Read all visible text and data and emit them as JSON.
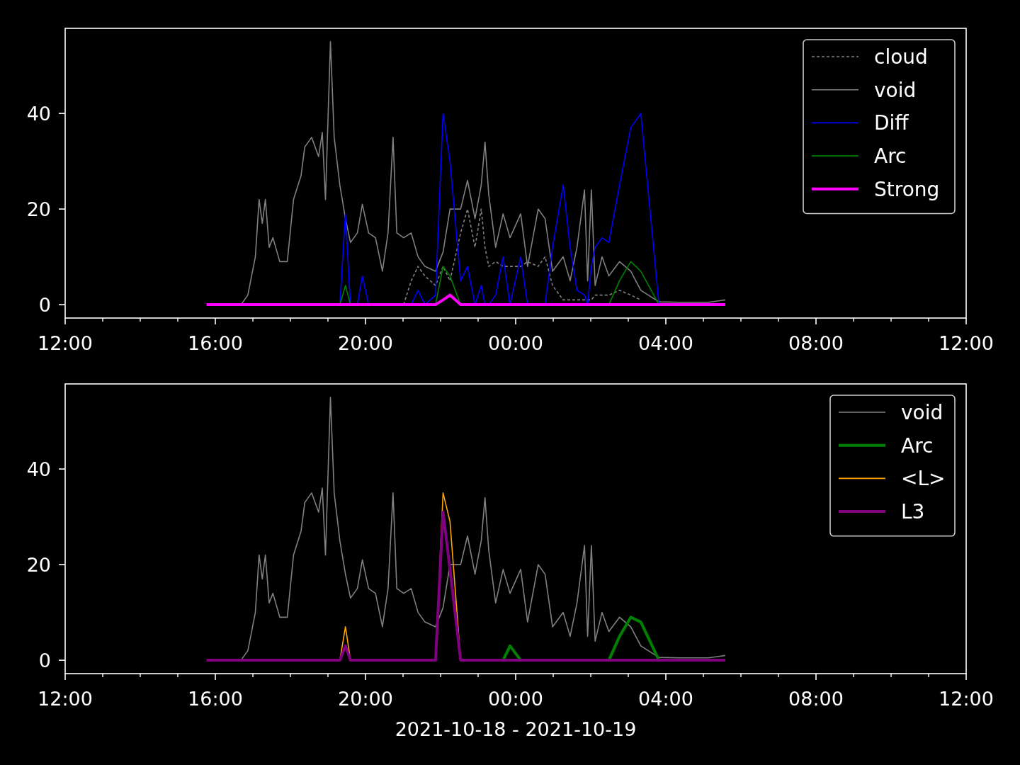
{
  "figure": {
    "charts": [
      {
        "line_kinds": [
          {
            "kind": "thin"
          },
          {
            "kind": "thin"
          },
          {
            "kind": "thin"
          },
          {
            "kind": "thin"
          },
          {
            "kind": "thick"
          }
        ],
        "chart_data": {
          "type": "line",
          "legend": true,
          "xlim": [
            "2021-10-18T12:00",
            "2021-10-19T12:00"
          ],
          "ylim": [
            -2.8,
            57.8
          ],
          "yticks": [
            0,
            20,
            40
          ],
          "xticks": [
            {
              "value": "2021-10-18T12:00",
              "label": "12:00"
            },
            {
              "value": "2021-10-18T16:00",
              "label": "16:00"
            },
            {
              "value": "2021-10-18T20:00",
              "label": "20:00"
            },
            {
              "value": "2021-10-19T00:00",
              "label": "00:00"
            },
            {
              "value": "2021-10-19T04:00",
              "label": "04:00"
            },
            {
              "value": "2021-10-19T08:00",
              "label": "08:00"
            },
            {
              "value": "2021-10-19T12:00",
              "label": "12:00"
            }
          ],
          "x": [
            "2021-10-18T15:46",
            "2021-10-18T16:41",
            "2021-10-18T16:52",
            "2021-10-18T17:04",
            "2021-10-18T17:10",
            "2021-10-18T17:15",
            "2021-10-18T17:20",
            "2021-10-18T17:26",
            "2021-10-18T17:32",
            "2021-10-18T17:43",
            "2021-10-18T17:55",
            "2021-10-18T18:05",
            "2021-10-18T18:17",
            "2021-10-18T18:23",
            "2021-10-18T18:34",
            "2021-10-18T18:45",
            "2021-10-18T18:51",
            "2021-10-18T18:56",
            "2021-10-18T19:04",
            "2021-10-18T19:10",
            "2021-10-18T19:19",
            "2021-10-18T19:28",
            "2021-10-18T19:36",
            "2021-10-18T19:47",
            "2021-10-18T19:55",
            "2021-10-18T20:05",
            "2021-10-18T20:16",
            "2021-10-18T20:27",
            "2021-10-18T20:36",
            "2021-10-18T20:44",
            "2021-10-18T20:50",
            "2021-10-18T21:01",
            "2021-10-18T21:13",
            "2021-10-18T21:24",
            "2021-10-18T21:35",
            "2021-10-18T21:52",
            "2021-10-18T22:04",
            "2021-10-18T22:15",
            "2021-10-18T22:32",
            "2021-10-18T22:43",
            "2021-10-18T22:55",
            "2021-10-18T23:05",
            "2021-10-18T23:11",
            "2021-10-18T23:17",
            "2021-10-18T23:28",
            "2021-10-18T23:40",
            "2021-10-18T23:51",
            "2021-10-19T00:08",
            "2021-10-19T00:19",
            "2021-10-19T00:36",
            "2021-10-19T00:47",
            "2021-10-19T00:59",
            "2021-10-19T01:16",
            "2021-10-19T01:27",
            "2021-10-19T01:38",
            "2021-10-19T01:50",
            "2021-10-19T01:55",
            "2021-10-19T02:01",
            "2021-10-19T02:07",
            "2021-10-19T02:18",
            "2021-10-19T02:29",
            "2021-10-19T02:46",
            "2021-10-19T03:04",
            "2021-10-19T03:20",
            "2021-10-19T03:49",
            "2021-10-19T04:23",
            "2021-10-19T05:08",
            "2021-10-19T05:35"
          ],
          "series": [
            {
              "name": "cloud",
              "color": "#808080",
              "line_style": "dashed",
              "values": [
                null,
                null,
                null,
                null,
                null,
                null,
                null,
                null,
                null,
                null,
                null,
                null,
                null,
                null,
                null,
                null,
                null,
                null,
                null,
                null,
                null,
                null,
                null,
                null,
                null,
                null,
                null,
                null,
                null,
                null,
                null,
                0,
                5,
                8,
                6,
                4,
                8,
                5,
                15,
                20,
                12,
                20,
                12,
                8,
                9,
                8,
                8,
                8,
                9,
                8,
                10,
                4,
                1,
                1,
                1,
                1,
                1,
                1,
                2,
                2,
                2,
                3,
                2,
                1,
                null,
                null,
                null,
                null
              ]
            },
            {
              "name": "void",
              "color": "#808080",
              "line_style": "solid",
              "values": [
                null,
                0,
                2,
                10,
                22,
                17,
                22,
                12,
                14,
                9,
                9,
                22,
                27,
                33,
                35,
                31,
                36,
                22,
                55,
                35,
                25,
                18,
                13,
                15,
                21,
                15,
                14,
                7,
                15,
                35,
                15,
                14,
                15,
                10,
                8,
                7,
                11,
                20,
                20,
                26,
                18,
                25,
                34,
                23,
                12,
                19,
                14,
                19,
                8,
                20,
                18,
                7,
                10,
                5,
                12,
                24,
                5,
                24,
                4,
                10,
                6,
                9,
                7,
                3,
                0.6,
                0.5,
                0.5,
                1
              ]
            },
            {
              "name": "Diff",
              "color": "#0000ff",
              "line_style": "solid",
              "values": [
                null,
                null,
                null,
                null,
                null,
                null,
                null,
                null,
                null,
                null,
                null,
                null,
                null,
                null,
                null,
                null,
                null,
                null,
                null,
                null,
                0,
                19,
                0,
                0,
                6,
                0,
                null,
                null,
                null,
                null,
                null,
                null,
                0,
                3,
                0,
                2,
                40,
                30,
                5,
                8,
                0,
                4,
                0,
                0,
                2,
                10,
                0,
                10,
                0,
                null,
                0,
                12,
                25,
                12,
                3,
                2,
                0,
                8,
                12,
                14,
                13,
                25,
                37,
                40,
                0,
                null,
                null,
                null
              ]
            },
            {
              "name": "Arc",
              "color": "#008000",
              "line_style": "solid",
              "values": [
                null,
                null,
                null,
                null,
                null,
                null,
                null,
                null,
                null,
                null,
                null,
                null,
                null,
                null,
                null,
                null,
                null,
                null,
                null,
                null,
                0,
                4,
                0,
                null,
                null,
                null,
                null,
                null,
                null,
                null,
                null,
                null,
                null,
                null,
                null,
                0,
                8,
                6,
                0,
                null,
                null,
                null,
                null,
                null,
                null,
                null,
                null,
                null,
                null,
                null,
                null,
                null,
                null,
                null,
                null,
                null,
                null,
                null,
                null,
                null,
                0,
                5,
                9,
                7,
                0,
                null,
                null,
                null
              ]
            },
            {
              "name": "Strong",
              "color": "#ff00ff",
              "line_style": "solid",
              "values": [
                0,
                0,
                0,
                0,
                0,
                0,
                0,
                0,
                0,
                0,
                0,
                0,
                0,
                0,
                0,
                0,
                0,
                0,
                0,
                0,
                0,
                0,
                0,
                0,
                0,
                0,
                0,
                0,
                0,
                0,
                0,
                0,
                0,
                0,
                0,
                0,
                1,
                2,
                0,
                0,
                0,
                0,
                0,
                0,
                0,
                0,
                0,
                0,
                0,
                0,
                0,
                0,
                0,
                0,
                0,
                0,
                0,
                0,
                0,
                0,
                0,
                0,
                0,
                0,
                0,
                0,
                0,
                0
              ]
            }
          ]
        }
      },
      {
        "line_kinds": [
          {
            "kind": "thin"
          },
          {
            "kind": "thick"
          },
          {
            "kind": "thin"
          },
          {
            "kind": "thick"
          }
        ],
        "chart_data": {
          "type": "line",
          "legend": true,
          "xlabel": "2021-10-18 - 2021-10-19",
          "xlim": [
            "2021-10-18T12:00",
            "2021-10-19T12:00"
          ],
          "ylim": [
            -2.8,
            57.8
          ],
          "yticks": [
            0,
            20,
            40
          ],
          "xticks": [
            {
              "value": "2021-10-18T12:00",
              "label": "12:00"
            },
            {
              "value": "2021-10-18T16:00",
              "label": "16:00"
            },
            {
              "value": "2021-10-18T20:00",
              "label": "20:00"
            },
            {
              "value": "2021-10-19T00:00",
              "label": "00:00"
            },
            {
              "value": "2021-10-19T04:00",
              "label": "04:00"
            },
            {
              "value": "2021-10-19T08:00",
              "label": "08:00"
            },
            {
              "value": "2021-10-19T12:00",
              "label": "12:00"
            }
          ],
          "x": [
            "2021-10-18T15:46",
            "2021-10-18T16:41",
            "2021-10-18T16:52",
            "2021-10-18T17:04",
            "2021-10-18T17:10",
            "2021-10-18T17:15",
            "2021-10-18T17:20",
            "2021-10-18T17:26",
            "2021-10-18T17:32",
            "2021-10-18T17:43",
            "2021-10-18T17:55",
            "2021-10-18T18:05",
            "2021-10-18T18:17",
            "2021-10-18T18:23",
            "2021-10-18T18:34",
            "2021-10-18T18:45",
            "2021-10-18T18:51",
            "2021-10-18T18:56",
            "2021-10-18T19:04",
            "2021-10-18T19:10",
            "2021-10-18T19:19",
            "2021-10-18T19:28",
            "2021-10-18T19:36",
            "2021-10-18T19:47",
            "2021-10-18T19:55",
            "2021-10-18T20:05",
            "2021-10-18T20:16",
            "2021-10-18T20:27",
            "2021-10-18T20:36",
            "2021-10-18T20:44",
            "2021-10-18T20:50",
            "2021-10-18T21:01",
            "2021-10-18T21:13",
            "2021-10-18T21:24",
            "2021-10-18T21:35",
            "2021-10-18T21:52",
            "2021-10-18T22:04",
            "2021-10-18T22:15",
            "2021-10-18T22:32",
            "2021-10-18T22:43",
            "2021-10-18T22:55",
            "2021-10-18T23:05",
            "2021-10-18T23:11",
            "2021-10-18T23:17",
            "2021-10-18T23:28",
            "2021-10-18T23:40",
            "2021-10-18T23:51",
            "2021-10-19T00:08",
            "2021-10-19T00:19",
            "2021-10-19T00:36",
            "2021-10-19T00:47",
            "2021-10-19T00:59",
            "2021-10-19T01:16",
            "2021-10-19T01:27",
            "2021-10-19T01:38",
            "2021-10-19T01:50",
            "2021-10-19T01:55",
            "2021-10-19T02:01",
            "2021-10-19T02:07",
            "2021-10-19T02:18",
            "2021-10-19T02:29",
            "2021-10-19T02:46",
            "2021-10-19T03:04",
            "2021-10-19T03:20",
            "2021-10-19T03:49",
            "2021-10-19T04:23",
            "2021-10-19T05:08",
            "2021-10-19T05:35"
          ],
          "series": [
            {
              "name": "void",
              "color": "#808080",
              "line_style": "solid",
              "values": [
                null,
                0,
                2,
                10,
                22,
                17,
                22,
                12,
                14,
                9,
                9,
                22,
                27,
                33,
                35,
                31,
                36,
                22,
                55,
                35,
                25,
                18,
                13,
                15,
                21,
                15,
                14,
                7,
                15,
                35,
                15,
                14,
                15,
                10,
                8,
                7,
                11,
                20,
                20,
                26,
                18,
                25,
                34,
                23,
                12,
                19,
                14,
                19,
                8,
                20,
                18,
                7,
                10,
                5,
                12,
                24,
                5,
                24,
                4,
                10,
                6,
                9,
                7,
                3,
                0.6,
                0.5,
                0.5,
                1
              ]
            },
            {
              "name": "Arc",
              "color": "#008000",
              "line_style": "solid",
              "values": [
                null,
                null,
                null,
                null,
                null,
                null,
                null,
                null,
                null,
                null,
                null,
                null,
                null,
                null,
                null,
                null,
                null,
                null,
                null,
                null,
                null,
                null,
                null,
                null,
                null,
                null,
                null,
                null,
                null,
                null,
                null,
                null,
                null,
                null,
                null,
                null,
                null,
                null,
                null,
                null,
                null,
                null,
                null,
                null,
                null,
                0,
                3,
                0,
                null,
                null,
                null,
                null,
                null,
                null,
                null,
                null,
                null,
                null,
                null,
                null,
                0,
                5,
                9,
                8,
                0,
                null,
                null,
                null
              ]
            },
            {
              "name": "<L>",
              "color": "#ffa500",
              "line_style": "solid",
              "values": [
                null,
                null,
                null,
                null,
                null,
                null,
                null,
                null,
                null,
                null,
                null,
                null,
                null,
                null,
                null,
                null,
                null,
                null,
                null,
                null,
                0,
                7,
                0,
                null,
                null,
                null,
                null,
                null,
                null,
                null,
                null,
                null,
                null,
                null,
                null,
                0,
                35,
                29,
                0,
                null,
                null,
                null,
                null,
                null,
                null,
                null,
                null,
                null,
                null,
                null,
                null,
                null,
                null,
                null,
                null,
                null,
                null,
                null,
                null,
                null,
                null,
                null,
                null,
                null,
                null,
                null,
                null,
                null
              ]
            },
            {
              "name": "L3",
              "color": "#800080",
              "line_style": "solid",
              "values": [
                0,
                0,
                0,
                0,
                0,
                0,
                0,
                0,
                0,
                0,
                0,
                0,
                0,
                0,
                0,
                0,
                0,
                0,
                0,
                0,
                0,
                3,
                0,
                0,
                0,
                0,
                0,
                0,
                0,
                0,
                0,
                0,
                0,
                0,
                0,
                0,
                31,
                19,
                0,
                0,
                0,
                0,
                0,
                0,
                0,
                0,
                0,
                0,
                0,
                0,
                0,
                0,
                0,
                0,
                0,
                0,
                0,
                0,
                0,
                0,
                0,
                0,
                0,
                0,
                0,
                0,
                0,
                0
              ]
            }
          ]
        }
      }
    ]
  }
}
